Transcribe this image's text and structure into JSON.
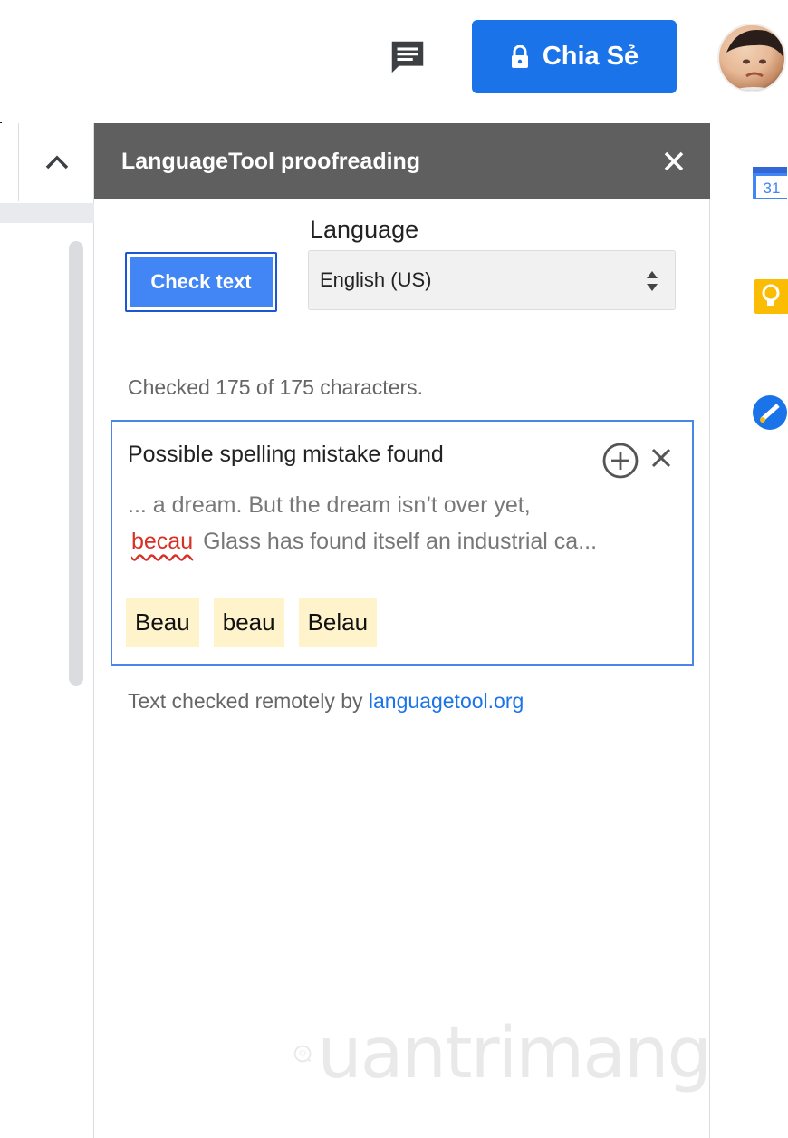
{
  "topbar": {
    "comments_icon": "comment-icon",
    "share_label": "Chia Sẻ",
    "share_icon": "lock-icon"
  },
  "doc": {
    "collapse_icon": "chevron-up-icon"
  },
  "sidebar": {
    "title": "LanguageTool proofreading",
    "close_icon": "close-icon",
    "language_label": "Language",
    "check_button": "Check text",
    "language_value": "English (US)",
    "checked_info": "Checked 175 of 175 characters.",
    "match": {
      "title": "Possible spelling mistake found",
      "context_before": "... a dream. But the dream isn’t over yet,",
      "error_word": "becau",
      "context_after": "Glass has found itself an industrial ca...",
      "suggestions": [
        "Beau",
        "beau",
        "Belau"
      ]
    },
    "footer_prefix": "Text checked remotely by",
    "footer_link": "languagetool.org"
  },
  "watermark": {
    "text": "uantrimang"
  },
  "right_rail": {
    "icons": [
      "calendar-icon",
      "keep-icon",
      "tasks-icon"
    ],
    "calendar_day": "31"
  },
  "colors": {
    "accent": "#1a73e8",
    "header_bg": "#5f5f5f",
    "suggestion_bg": "#fff3cc",
    "error": "#d93025"
  }
}
